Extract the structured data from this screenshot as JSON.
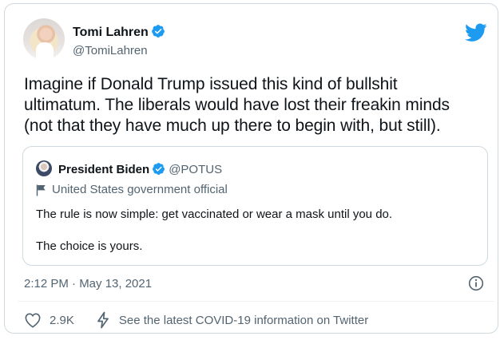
{
  "tweet": {
    "author_name": "Tomi Lahren",
    "author_handle": "@TomiLahren",
    "text": "Imagine if Donald Trump issued this kind of bullshit\nultimatum. The liberals would have lost their freakin minds\n(not that they have much up there to begin with, but still).",
    "timestamp": "2:12 PM · May 13, 2021",
    "likes": "2.9K",
    "covid_link": "See the latest COVID-19 information on Twitter"
  },
  "quoted": {
    "author_name": "President Biden",
    "author_handle": "@POTUS",
    "label": "United States government official",
    "text": "The rule is now simple: get vaccinated or wear a mask until you do.\n\nThe choice is yours."
  },
  "colors": {
    "twitter_blue": "#1d9bf0",
    "secondary_text": "#536471",
    "border": "#cfd9de"
  },
  "icons": [
    "verified-badge-icon",
    "twitter-bird-icon",
    "flag-icon",
    "info-icon",
    "heart-icon",
    "bolt-icon"
  ]
}
